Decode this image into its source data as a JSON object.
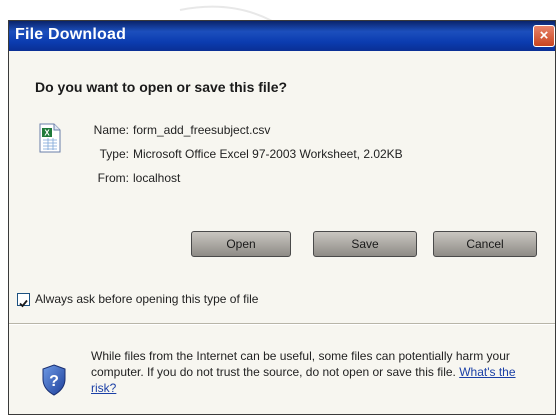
{
  "window": {
    "title": "File Download",
    "close_label": "×"
  },
  "question": "Do you want to open or save this file?",
  "file_info": {
    "name_label": "Name:",
    "name_value": "form_add_freesubject.csv",
    "type_label": "Type:",
    "type_value": "Microsoft Office Excel 97-2003 Worksheet, 2.02KB",
    "from_label": "From:",
    "from_value": "localhost"
  },
  "buttons": {
    "open": "Open",
    "save": "Save",
    "cancel": "Cancel"
  },
  "checkbox": {
    "label": "Always ask before opening this type of file",
    "checked": true
  },
  "warning": {
    "text": "While files from the Internet can be useful, some files can potentially harm your computer. If you do not trust the source, do not open or save this file.",
    "link": "What's the risk?"
  },
  "icons": {
    "file": "excel-file-icon",
    "shield": "security-shield-question-icon",
    "check": "checkmark-icon"
  },
  "colors": {
    "titlebar": "#0a246a",
    "dialog_bg": "#ece9d8",
    "link": "#1a3fa6"
  }
}
